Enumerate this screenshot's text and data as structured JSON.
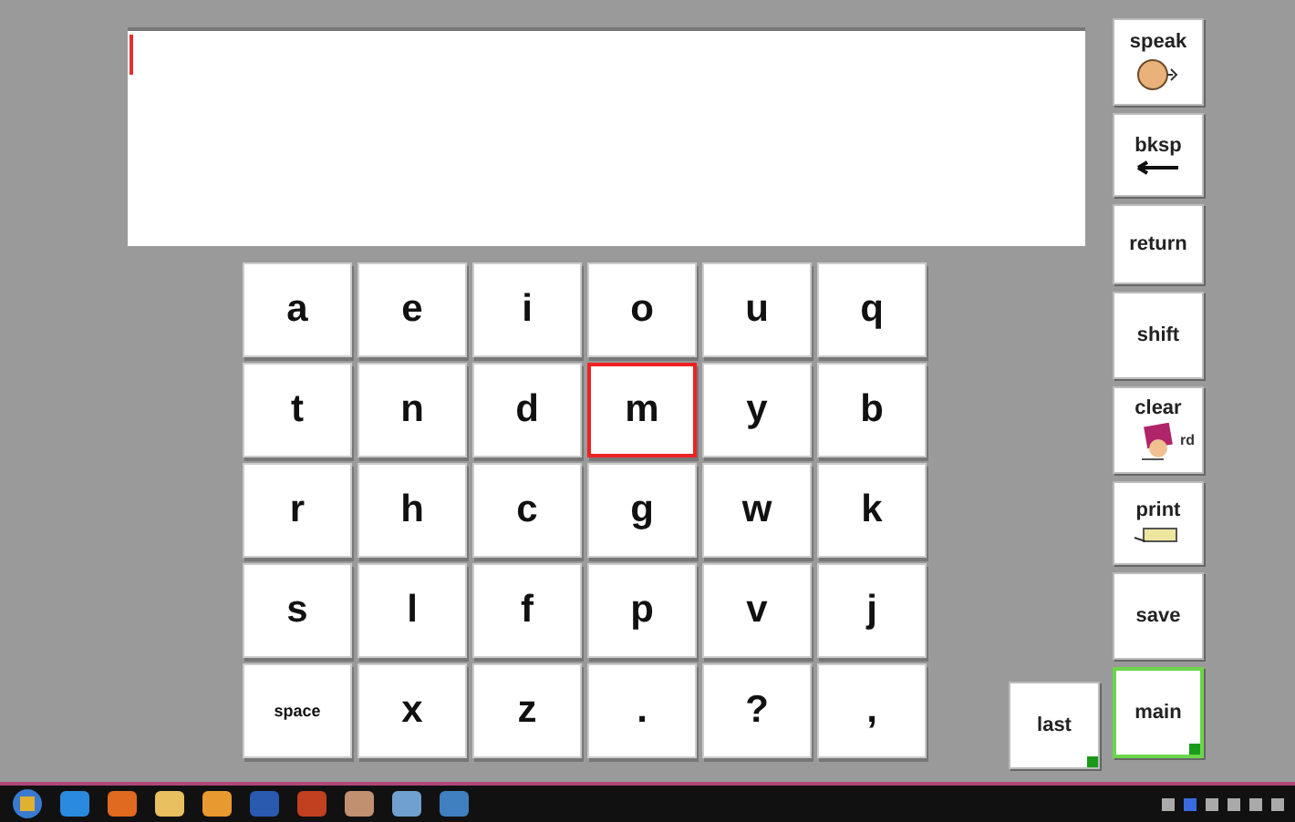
{
  "keys": [
    [
      {
        "label": "a",
        "selected": false
      },
      {
        "label": "e",
        "selected": false
      },
      {
        "label": "i",
        "selected": false
      },
      {
        "label": "o",
        "selected": false
      },
      {
        "label": "u",
        "selected": false
      },
      {
        "label": "q",
        "selected": false
      }
    ],
    [
      {
        "label": "t",
        "selected": false
      },
      {
        "label": "n",
        "selected": false
      },
      {
        "label": "d",
        "selected": false
      },
      {
        "label": "m",
        "selected": true
      },
      {
        "label": "y",
        "selected": false
      },
      {
        "label": "b",
        "selected": false
      }
    ],
    [
      {
        "label": "r",
        "selected": false
      },
      {
        "label": "h",
        "selected": false
      },
      {
        "label": "c",
        "selected": false
      },
      {
        "label": "g",
        "selected": false
      },
      {
        "label": "w",
        "selected": false
      },
      {
        "label": "k",
        "selected": false
      }
    ],
    [
      {
        "label": "s",
        "selected": false
      },
      {
        "label": "l",
        "selected": false
      },
      {
        "label": "f",
        "selected": false
      },
      {
        "label": "p",
        "selected": false
      },
      {
        "label": "v",
        "selected": false
      },
      {
        "label": "j",
        "selected": false
      }
    ],
    [
      {
        "label": "space",
        "selected": false
      },
      {
        "label": "x",
        "selected": false
      },
      {
        "label": "z",
        "selected": false
      },
      {
        "label": ".",
        "selected": false
      },
      {
        "label": "?",
        "selected": false
      },
      {
        "label": ",",
        "selected": false
      }
    ]
  ],
  "last_button": {
    "label": "last",
    "linked": true,
    "selected": false
  },
  "side_buttons": [
    {
      "label": "speak",
      "kind": "head",
      "selected": false,
      "linked": false
    },
    {
      "label": "bksp",
      "kind": "arrow",
      "selected": false,
      "linked": false
    },
    {
      "label": "return",
      "selected": false,
      "linked": false
    },
    {
      "label": "shift",
      "selected": false,
      "linked": false
    },
    {
      "label": "clear",
      "kind": "card",
      "caption": "rd",
      "selected": false,
      "linked": false
    },
    {
      "label": "print",
      "kind": "printer",
      "selected": false,
      "linked": false
    },
    {
      "label": "save",
      "selected": false,
      "linked": false
    },
    {
      "label": "main",
      "selected": true,
      "linked": true
    }
  ]
}
